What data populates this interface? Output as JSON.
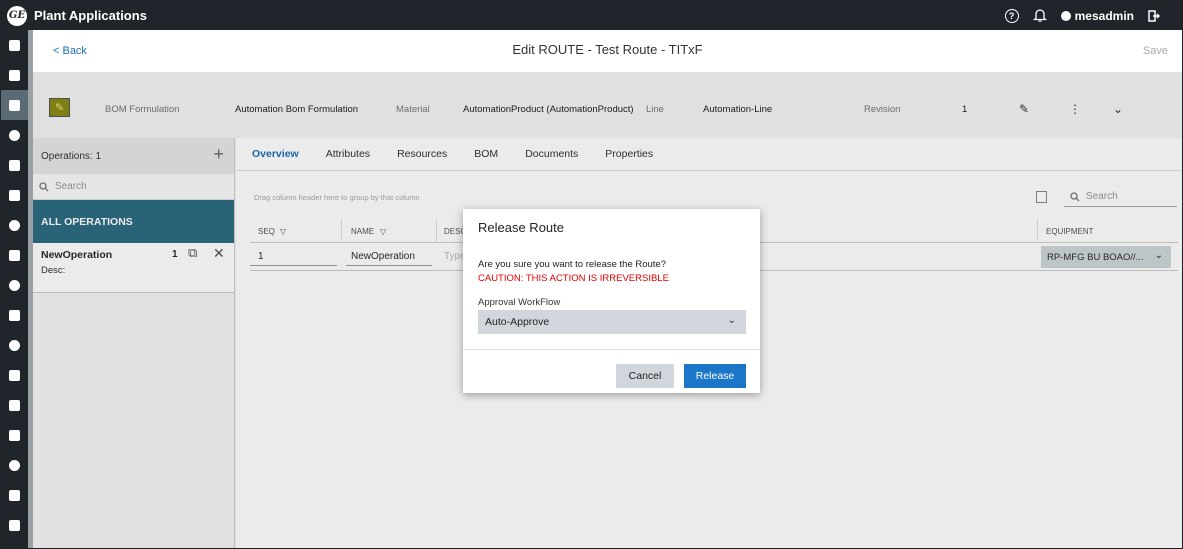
{
  "app": {
    "title": "Plant Applications",
    "logo_text": "GE"
  },
  "topbar": {
    "help_icon_glyph": "?",
    "user": "mesadmin"
  },
  "header": {
    "back_label": "< Back",
    "title": "Edit ROUTE - Test Route - TITxF",
    "save_label": "Save"
  },
  "info": {
    "bom_formulation_label": "BOM Formulation",
    "bom_formulation_value": "Automation Bom Formulation",
    "material_label": "Material",
    "material_value": "AutomationProduct (AutomationProduct)",
    "line_label": "Line",
    "line_value": "Automation-Line",
    "revision_label": "Revision",
    "revision_value": "1"
  },
  "operations": {
    "header": "Operations: 1",
    "search_placeholder": "Search",
    "all_label": "ALL OPERATIONS",
    "items": [
      {
        "name": "NewOperation",
        "count": "1",
        "desc": "Desc:"
      }
    ]
  },
  "tabs": [
    {
      "label": "Overview",
      "active": true
    },
    {
      "label": "Attributes"
    },
    {
      "label": "Resources"
    },
    {
      "label": "BOM"
    },
    {
      "label": "Documents"
    },
    {
      "label": "Properties"
    }
  ],
  "grid": {
    "group_hint": "Drag column header here to group by that column",
    "search_placeholder": "Search",
    "columns": {
      "seq": "SEQ",
      "name": "NAME",
      "desc": "DESC",
      "equipment": "EQUIPMENT"
    },
    "rows": [
      {
        "seq": "1",
        "name": "NewOperation",
        "desc_placeholder": "Type",
        "equipment": "RP-MFG BU BOAO//..."
      }
    ]
  },
  "modal": {
    "title": "Release Route",
    "question": "Are you sure you want to release the Route?",
    "caution": "CAUTION: THIS ACTION IS IRREVERSIBLE",
    "workflow_label": "Approval WorkFlow",
    "workflow_value": "Auto-Approve",
    "cancel_label": "Cancel",
    "release_label": "Release"
  },
  "colors": {
    "accent": "#1b75c9",
    "teal": "#2d6c82",
    "caution": "#e00000",
    "topbar": "#1f252b"
  }
}
